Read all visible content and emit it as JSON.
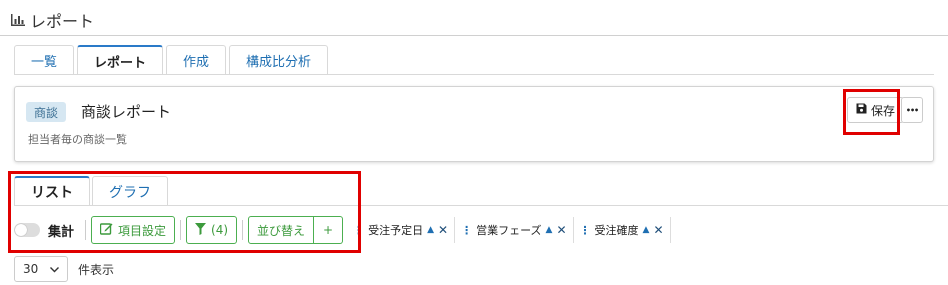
{
  "header": {
    "title": "レポート",
    "icon": "bar-chart-icon"
  },
  "tabs": [
    {
      "label": "一覧",
      "active": false
    },
    {
      "label": "レポート",
      "active": true
    },
    {
      "label": "作成",
      "active": false
    },
    {
      "label": "構成比分析",
      "active": false
    }
  ],
  "report": {
    "badge": "商談",
    "title": "商談レポート",
    "description": "担当者毎の商談一覧",
    "save_label": "保存",
    "more_label": "•••"
  },
  "subtabs": [
    {
      "label": "リスト",
      "active": true
    },
    {
      "label": "グラフ",
      "active": false
    }
  ],
  "toolbar": {
    "aggregate_label": "集計",
    "item_settings_label": "項目設定",
    "filter_label": "(4)",
    "sort_label": "並び替え",
    "add_label": "+",
    "sort_chips": [
      "受注予定日",
      "営業フェーズ",
      "受注確度"
    ]
  },
  "pagination": {
    "per_page": "30",
    "suffix": "件表示"
  },
  "colors": {
    "accent": "#2a7ac8",
    "green": "#4caf50",
    "highlight": "#e00000"
  }
}
